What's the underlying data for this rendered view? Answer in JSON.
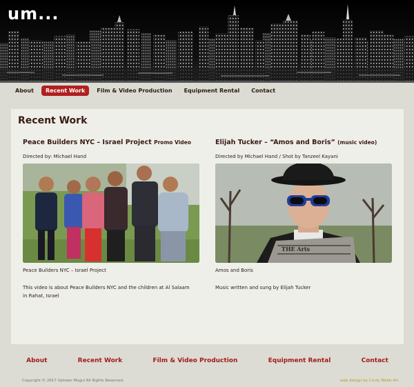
{
  "header": {
    "logo_text": "um..."
  },
  "topnav": {
    "items": [
      {
        "label": "About",
        "active": false
      },
      {
        "label": "Recent Work",
        "active": true
      },
      {
        "label": "Film & Video Production",
        "active": false
      },
      {
        "label": "Equipment Rental",
        "active": false
      },
      {
        "label": "Contact",
        "active": false
      }
    ]
  },
  "main": {
    "title": "Recent Work",
    "projects": [
      {
        "title": "Peace Builders NYC – Israel Project",
        "subtitle": "Promo Video",
        "credit": "Directed by: Michael Hand",
        "caption": "Peace Builders NYC – Israel Project",
        "description": "This video is about Peace Builders NYC and the children at Al Salaam in Rahat, Israel"
      },
      {
        "title": "Elijah Tucker – “Amos and Boris”",
        "subtitle": "(music video)",
        "credit": "Directed by Michael Hand / Shot by Tanzeel Kayani",
        "caption": "Amos and Boris",
        "description": "Music written and sung by Elijah Tucker",
        "paper_text": "THE Arts"
      }
    ]
  },
  "footer": {
    "nav": [
      "About",
      "Recent Work",
      "Film & Video Production",
      "Equipment Rental",
      "Contact"
    ],
    "copyright": "Copyright © 2017 Uptown Mogul All Rights Reserved.",
    "design_credit": "web design by Cindy Webb Art"
  },
  "colors": {
    "accent": "#b0201e",
    "footer_link": "#a21c1a",
    "page_bg": "#dcdcd4",
    "card_bg": "#efefea"
  }
}
